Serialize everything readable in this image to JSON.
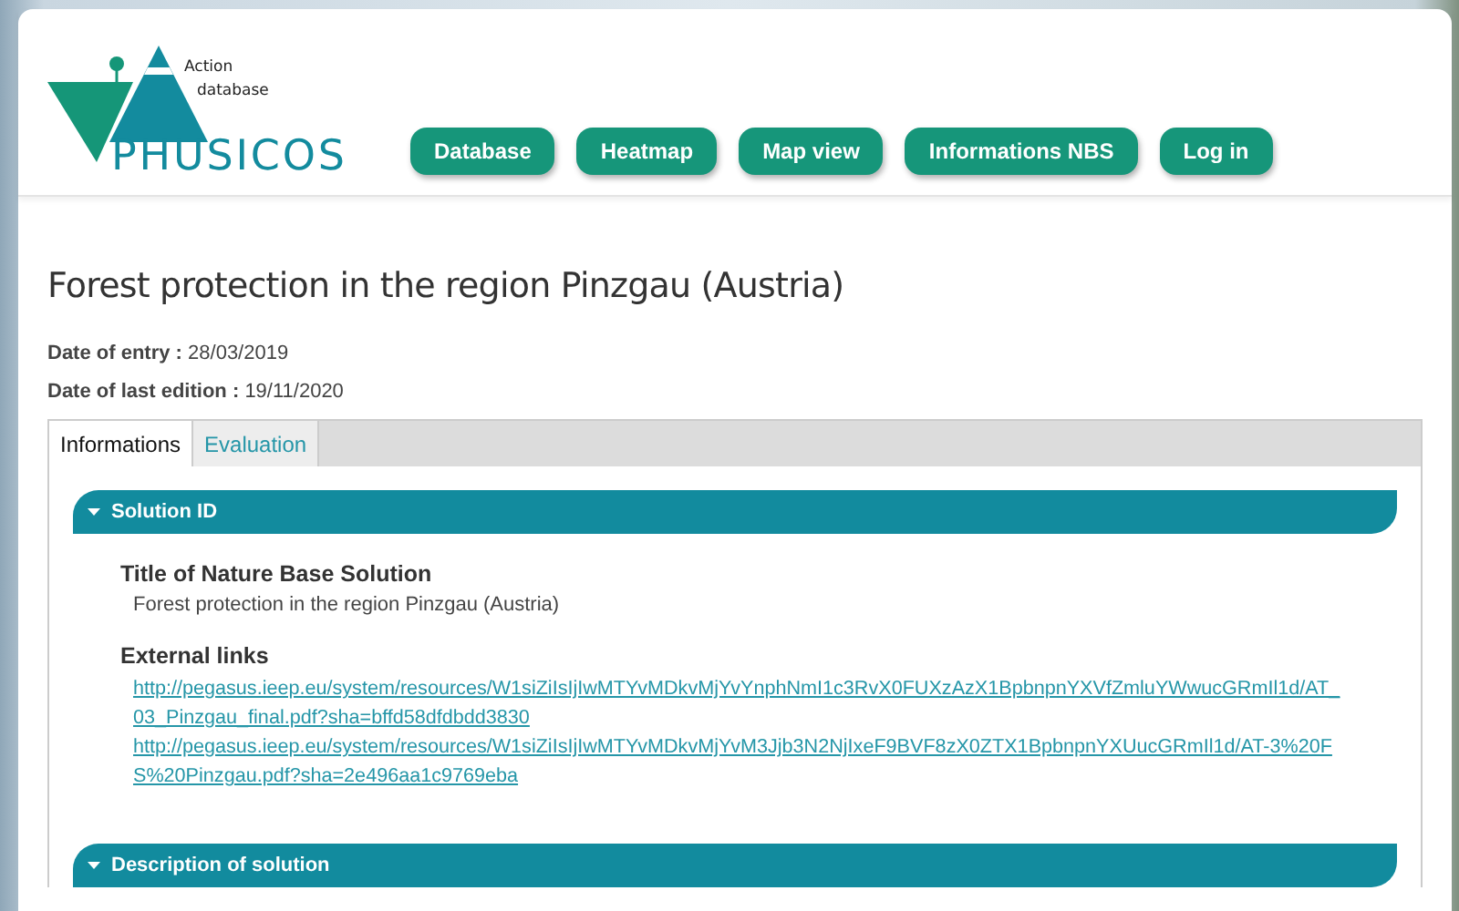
{
  "logo": {
    "line_1": "Action",
    "line_2": "database",
    "name": "PHUSICOS"
  },
  "nav": [
    "Database",
    "Heatmap",
    "Map view",
    "Informations NBS",
    "Log in"
  ],
  "title": "Forest protection in the region Pinzgau (Austria)",
  "meta": [
    {
      "label": "Date of entry :",
      "value": "28/03/2019"
    },
    {
      "label": "Date of last edition :",
      "value": "19/11/2020"
    }
  ],
  "tabs": [
    {
      "label": "Informations",
      "selected": true
    },
    {
      "label": "Evaluation",
      "selected": false
    }
  ],
  "sections": [
    {
      "title": "Solution ID",
      "expanded": true,
      "fields": [
        {
          "kind": "text",
          "label": "Title of Nature Base Solution",
          "values": [
            "Forest protection in the region Pinzgau (Austria)"
          ]
        },
        {
          "kind": "links",
          "label": "External links",
          "values": [
            "http://pegasus.ieep.eu/system/resources/W1siZiIsIjIwMTYvMDkvMjYvYnphNmI1c3RvX0FUXzAzX1BpbnpnYXVfZmluYWwucGRmIl1d/AT_03_Pinzgau_final.pdf?sha=bffd58dfdbdd3830",
            "http://pegasus.ieep.eu/system/resources/W1siZiIsIjIwMTYvMDkvMjYvM3Jjb3N2NjIxeF9BVF8zX0ZTX1BpbnpnYXUucGRmIl1d/AT-3%20FS%20Pinzgau.pdf?sha=2e496aa1c9769eba"
          ]
        }
      ]
    },
    {
      "title": "Description of solution",
      "expanded": true
    }
  ]
}
